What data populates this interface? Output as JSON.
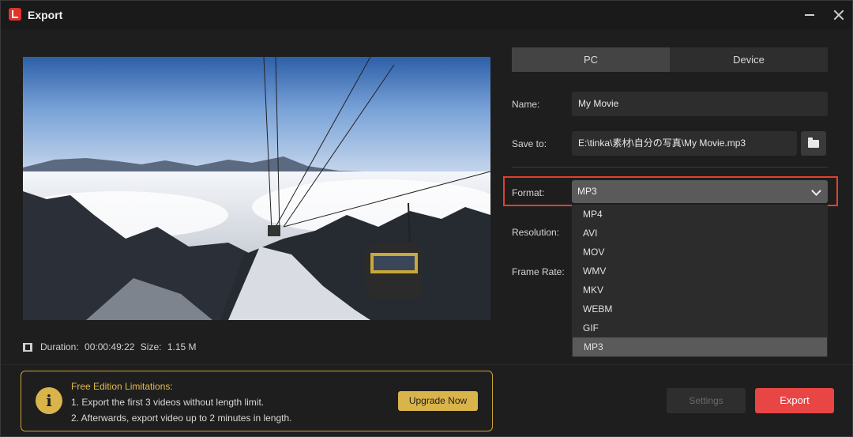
{
  "window": {
    "title": "Export"
  },
  "preview": {
    "duration_label": "Duration:",
    "duration_value": "00:00:49:22",
    "size_label": "Size:",
    "size_value": "1.15 M"
  },
  "tabs": [
    {
      "label": "PC",
      "active": true
    },
    {
      "label": "Device",
      "active": false
    }
  ],
  "form": {
    "name_label": "Name:",
    "name_value": "My Movie",
    "save_to_label": "Save to:",
    "save_to_value": "E:\\tinka\\素材\\自分の写真\\My Movie.mp3",
    "format_label": "Format:",
    "format_value": "MP3",
    "resolution_label": "Resolution:",
    "frame_rate_label": "Frame Rate:"
  },
  "format_options": [
    "MP4",
    "AVI",
    "MOV",
    "WMV",
    "MKV",
    "WEBM",
    "GIF",
    "MP3"
  ],
  "limits": {
    "title": "Free Edition Limitations:",
    "line1": "1. Export the first 3 videos without length limit.",
    "line2": "2. Afterwards, export video up to 2 minutes in length.",
    "upgrade_label": "Upgrade Now"
  },
  "buttons": {
    "settings": "Settings",
    "export": "Export"
  },
  "colors": {
    "accent": "#e84545",
    "highlight": "#e0402f",
    "gold": "#d9b44a"
  }
}
